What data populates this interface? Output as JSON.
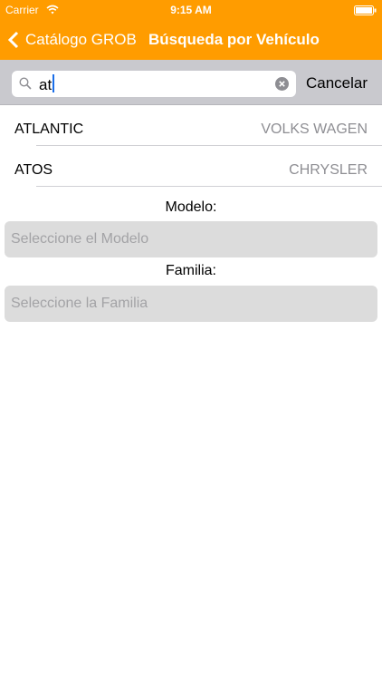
{
  "status_bar": {
    "carrier": "Carrier",
    "time": "9:15 AM"
  },
  "nav": {
    "back_label": "Catálogo GROB",
    "title": "Búsqueda por Vehículo"
  },
  "search": {
    "query": "at",
    "cancel_label": "Cancelar"
  },
  "results": [
    {
      "name": "ATLANTIC",
      "brand": "VOLKS WAGEN"
    },
    {
      "name": "ATOS",
      "brand": "CHRYSLER"
    }
  ],
  "form": {
    "modelo_label": "Modelo:",
    "modelo_placeholder": "Seleccione el Modelo",
    "familia_label": "Familia:",
    "familia_placeholder": "Seleccione la Familia"
  },
  "colors": {
    "accent": "#ff9c00",
    "search_bar_bg": "#c9c9ce",
    "select_bg": "#dcdcdc"
  },
  "icons": [
    "wifi-icon",
    "battery-icon",
    "back-chevron-icon",
    "search-icon",
    "clear-icon"
  ]
}
